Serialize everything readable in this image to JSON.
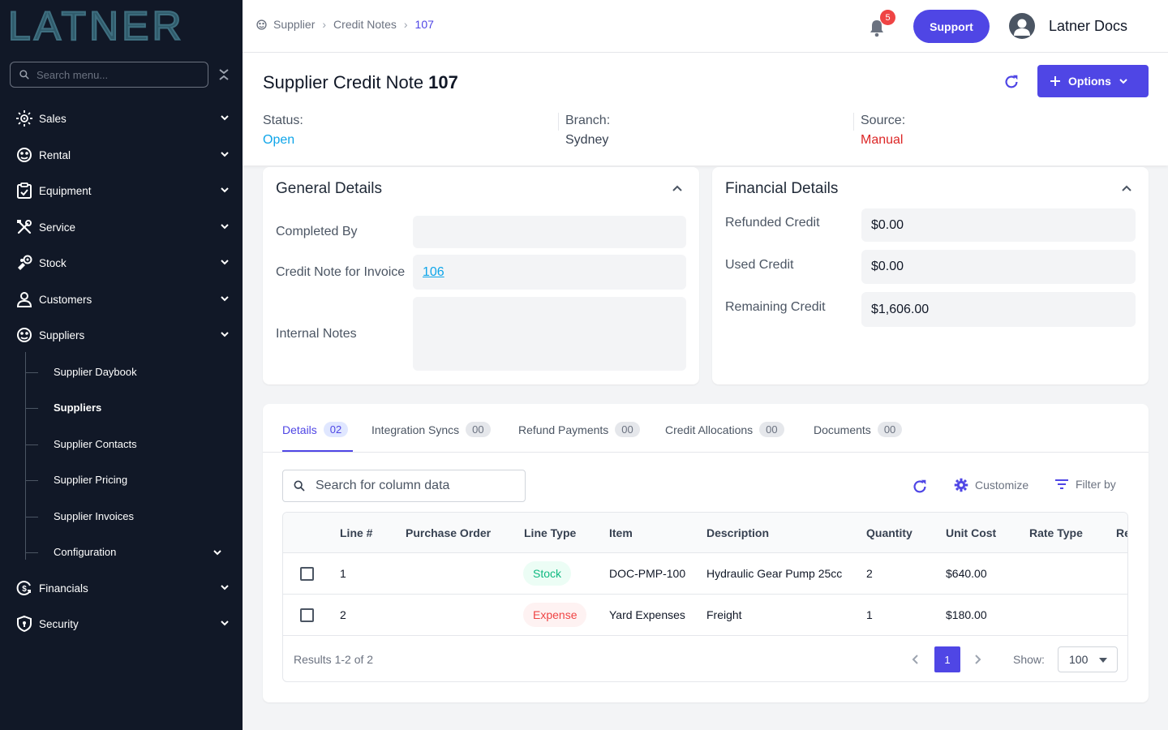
{
  "app": {
    "logo_text": "LATNER",
    "brand_color": "#4f46e5"
  },
  "sidebar": {
    "search_placeholder": "Search menu...",
    "items": [
      {
        "label": "Sales",
        "icon": "sales-icon"
      },
      {
        "label": "Rental",
        "icon": "rental-icon"
      },
      {
        "label": "Equipment",
        "icon": "equipment-icon"
      },
      {
        "label": "Service",
        "icon": "service-icon"
      },
      {
        "label": "Stock",
        "icon": "stock-icon"
      },
      {
        "label": "Customers",
        "icon": "customers-icon"
      },
      {
        "label": "Suppliers",
        "icon": "suppliers-icon"
      },
      {
        "label": "Financials",
        "icon": "financials-icon"
      },
      {
        "label": "Security",
        "icon": "security-icon"
      }
    ],
    "sub_items": [
      {
        "label": "Supplier Daybook"
      },
      {
        "label": "Suppliers",
        "active": true
      },
      {
        "label": "Supplier Contacts"
      },
      {
        "label": "Supplier Pricing"
      },
      {
        "label": "Supplier Invoices"
      },
      {
        "label": "Configuration"
      }
    ]
  },
  "topbar": {
    "breadcrumbs": [
      "Supplier",
      "Credit Notes",
      "107"
    ],
    "notification_count": "5",
    "support_label": "Support",
    "user_name": "Latner Docs"
  },
  "page": {
    "title": "Supplier Credit Note",
    "number": "107",
    "options_label": "Options",
    "status": {
      "label": "Status:",
      "value": "Open",
      "color": "#0ea5e9"
    },
    "branch": {
      "label": "Branch:",
      "value": "Sydney",
      "color": "#374151"
    },
    "source": {
      "label": "Source:",
      "value": "Manual",
      "color": "#dc2626"
    }
  },
  "general": {
    "title": "General Details",
    "completed_by_label": "Completed By",
    "completed_by_value": "",
    "invoice_label": "Credit Note for Invoice",
    "invoice_value": "106",
    "notes_label": "Internal Notes",
    "notes_value": ""
  },
  "financial": {
    "title": "Financial Details",
    "refunded_label": "Refunded Credit",
    "refunded_value": "$0.00",
    "used_label": "Used Credit",
    "used_value": "$0.00",
    "remaining_label": "Remaining Credit",
    "remaining_value": "$1,606.00"
  },
  "tabs": [
    {
      "label": "Details",
      "count": "02",
      "active": true
    },
    {
      "label": "Integration Syncs",
      "count": "00"
    },
    {
      "label": "Refund Payments",
      "count": "00"
    },
    {
      "label": "Credit Allocations",
      "count": "00"
    },
    {
      "label": "Documents",
      "count": "00"
    }
  ],
  "table": {
    "search_placeholder": "Search for column data",
    "customize_label": "Customize",
    "filter_label": "Filter by",
    "columns": [
      "Line #",
      "Purchase Order",
      "Line Type",
      "Item",
      "Description",
      "Quantity",
      "Unit Cost",
      "Rate Type",
      "Re"
    ],
    "rows": [
      {
        "line": "1",
        "po": "",
        "type": "Stock",
        "item": "DOC-PMP-100",
        "description": "Hydraulic Gear Pump 25cc",
        "quantity": "2",
        "unit_cost": "$640.00",
        "rate_type": ""
      },
      {
        "line": "2",
        "po": "",
        "type": "Expense",
        "item": "Yard Expenses",
        "description": "Freight",
        "quantity": "1",
        "unit_cost": "$180.00",
        "rate_type": ""
      }
    ],
    "results_text": "Results 1-2 of 2",
    "current_page": "1",
    "show_label": "Show:",
    "page_size": "100"
  }
}
